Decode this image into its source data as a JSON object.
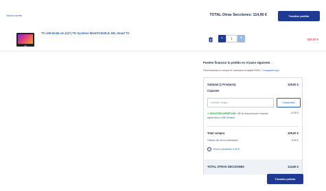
{
  "header": {
    "empty_cart_link": "Vaciar carrito",
    "total_label": "TOTAL Otras Secciones:",
    "total_value": "114,90 €",
    "checkout_button": "Tramitar pedido"
  },
  "product": {
    "name": "TV LED 60,96 cm (24\") TD Systems M24CF15X0LE, HD, Smart TV",
    "quantity": "1",
    "price": "129,00 €",
    "minus_label": "–",
    "plus_label": "+"
  },
  "financing": {
    "title": "Puedes financiar tu pedido en el paso siguiente.",
    "text": "Para financiar tu compra es necesaria la tarjeta PASS.",
    "link": "Consíguela aquí"
  },
  "summary": {
    "subtotal_label": "Subtotal (1 Producto)",
    "subtotal_value": "129,00 €",
    "coupons_label": "Cupones",
    "coupon_placeholder": "Insertar código...",
    "apply_button": "Comprobar",
    "coupon_code": "DISASTERCARREFOUR",
    "coupon_desc_1": ": 10€ de descuento por",
    "coupon_desc_2": "compras superiores a 100€.",
    "coupon_remove": "Eliminar",
    "coupon_value": "-10,00 €",
    "total_compra_label": "Total compra",
    "total_compra_value": "109,00 €",
    "shipping_label": "Gastos de envío estimados",
    "shipping_value": "5,90 €",
    "shipping_option": "Envío a domicilio: 5,90 €",
    "total_sections_label": "TOTAL OTRAS SECCIONES",
    "total_sections_value": "114,90 €"
  },
  "footer": {
    "checkout_button": "Tramitar pedido"
  },
  "colors": {
    "primary": "#1f3a93",
    "link": "#1b5fc4",
    "price_red": "#d6132c",
    "coupon_green": "#2e9e47"
  }
}
